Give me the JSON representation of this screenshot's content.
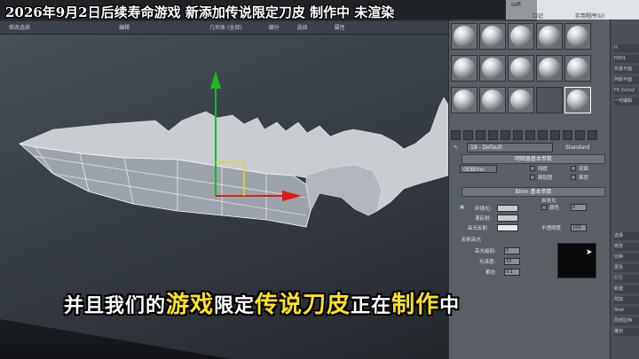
{
  "video_title": "2026年9月2日后续寿命游戏 新添加传说限定刀皮 制作中 未渲染",
  "menubar": {
    "items": [
      "修改选择",
      "编辑",
      "几何体 (全部)",
      "细分",
      "选择",
      "属性"
    ]
  },
  "ribbon": {
    "items": [
      "osft",
      "口记",
      "实用程序(U)"
    ]
  },
  "viewport": {
    "label": "Perspective viewport",
    "gizmo_axes": {
      "y_color": "#1fb81f",
      "x_color": "#e01818"
    }
  },
  "material_editor": {
    "slot_count": 15,
    "active_slot": 14,
    "empty_slots": [
      13
    ],
    "material_name": "18 - Default",
    "material_type": "Standard",
    "shader_section": "明暗器基本参数",
    "shader_type": "(B)Blinn",
    "shader_options": [
      "线框",
      "双面",
      "面贴图",
      "面状"
    ],
    "blinn_section": "Blinn 基本参数",
    "self_illum_label": "自发光",
    "self_illum_color_label": "颜色",
    "self_illum_value": "0",
    "ambient_label": "环境光:",
    "diffuse_label": "漫反射:",
    "specular_label": "高光反射:",
    "opacity_label": "不透明度",
    "opacity_value": "100",
    "highlight_section": "反射高光",
    "specular_level_label": "高光级别:",
    "specular_level_value": "0",
    "glossiness_label": "光泽度:",
    "glossiness_value": "10",
    "soften_label": "柔化:",
    "soften_value": "0.1"
  },
  "right_strip": {
    "items": [
      "H",
      "H001",
      "布基平面",
      "阿斯平面",
      "F0 2x2x2",
      "一可编辑"
    ]
  },
  "right_strip_lower": {
    "items": [
      "选择",
      "修改",
      "切换",
      "更改",
      "行行",
      "新建",
      "附加",
      "Shel",
      "局部拉伸",
      "雕刻"
    ]
  },
  "subtitle": {
    "parts": [
      {
        "text": "并且我们的",
        "style": "w"
      },
      {
        "text": "游戏",
        "style": "y"
      },
      {
        "text": "限定",
        "style": "w"
      },
      {
        "text": "传说刀皮",
        "style": "y"
      },
      {
        "text": "正在",
        "style": "w"
      },
      {
        "text": "制作",
        "style": "y"
      },
      {
        "text": "中",
        "style": "w"
      }
    ]
  }
}
